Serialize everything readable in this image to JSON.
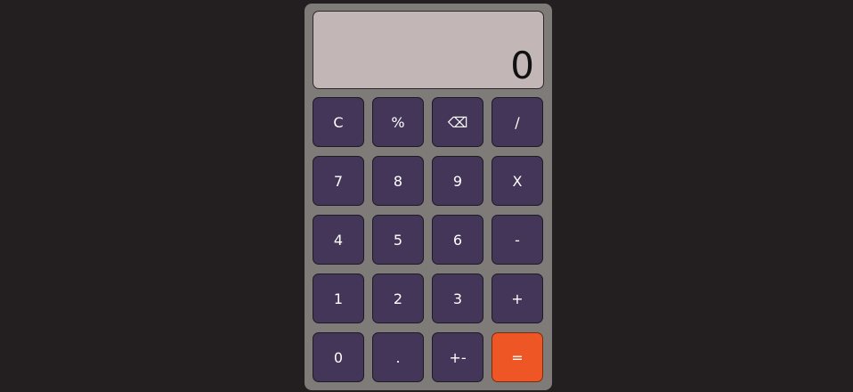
{
  "display": {
    "value": "0"
  },
  "colors": {
    "background": "#231f20",
    "body": "#7f7b79",
    "screen": "#c2b6b6",
    "key": "#433658",
    "equals": "#ee5725"
  },
  "keys": [
    {
      "label": "C",
      "icon": ""
    },
    {
      "label": "%",
      "icon": ""
    },
    {
      "label": "⌫",
      "icon": "backspace-icon"
    },
    {
      "label": "/",
      "icon": ""
    },
    {
      "label": "7",
      "icon": ""
    },
    {
      "label": "8",
      "icon": ""
    },
    {
      "label": "9",
      "icon": ""
    },
    {
      "label": "X",
      "icon": ""
    },
    {
      "label": "4",
      "icon": ""
    },
    {
      "label": "5",
      "icon": ""
    },
    {
      "label": "6",
      "icon": ""
    },
    {
      "label": "-",
      "icon": ""
    },
    {
      "label": "1",
      "icon": ""
    },
    {
      "label": "2",
      "icon": ""
    },
    {
      "label": "3",
      "icon": ""
    },
    {
      "label": "+",
      "icon": ""
    },
    {
      "label": "0",
      "icon": ""
    },
    {
      "label": ".",
      "icon": ""
    },
    {
      "label": "+-",
      "icon": ""
    },
    {
      "label": "=",
      "icon": ""
    }
  ]
}
